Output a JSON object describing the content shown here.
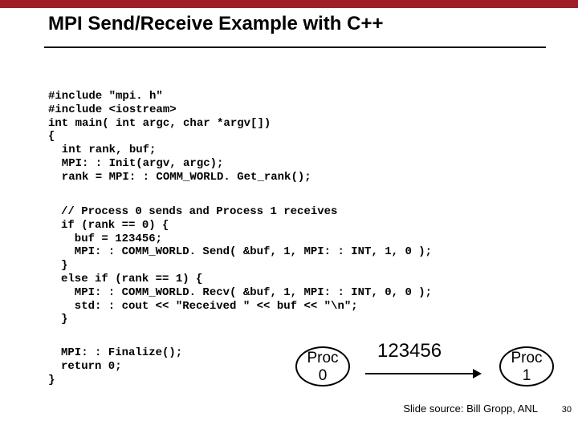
{
  "title": "MPI Send/Receive Example with C++",
  "code": {
    "b1": "#include \"mpi. h\"\n#include <iostream>\nint main( int argc, char *argv[])\n{\n  int rank, buf;\n  MPI: : Init(argv, argc);\n  rank = MPI: : COMM_WORLD. Get_rank();",
    "b2": "// Process 0 sends and Process 1 receives\nif (rank == 0) {\n  buf = 123456;\n  MPI: : COMM_WORLD. Send( &buf, 1, MPI: : INT, 1, 0 );\n}\nelse if (rank == 1) {\n  MPI: : COMM_WORLD. Recv( &buf, 1, MPI: : INT, 0, 0 );\n  std: : cout << \"Received \" << buf << \"\\n\";\n}",
    "b3": "MPI: : Finalize();\nreturn 0;",
    "brace": "}"
  },
  "diagram": {
    "proc0": "Proc\n0",
    "proc1": "Proc\n1",
    "value": "123456"
  },
  "credit": "Slide source: Bill Gropp, ANL",
  "pagenum": "30"
}
